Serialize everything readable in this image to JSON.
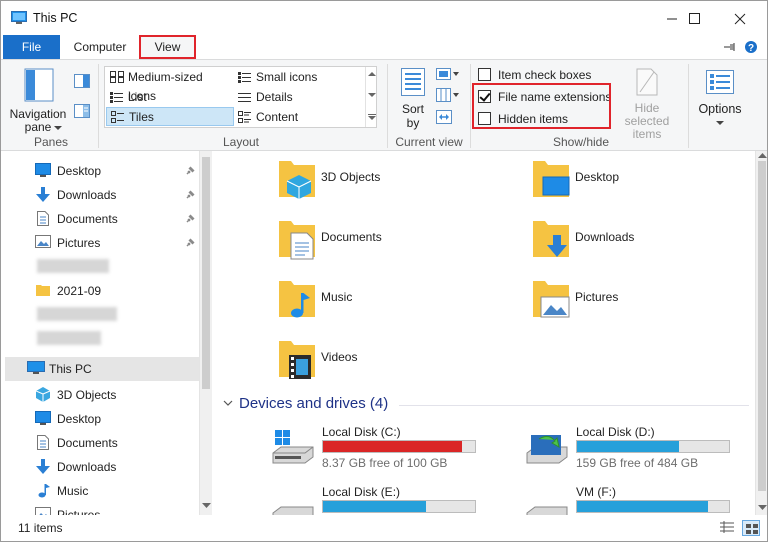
{
  "window": {
    "title": "This PC"
  },
  "ribbon_tabs": {
    "file": "File",
    "computer": "Computer",
    "view": "View"
  },
  "ribbon": {
    "panes": {
      "navigation_pane": "Navigation pane",
      "group_label": "Panes"
    },
    "layout": {
      "items": [
        "Medium-sized icons",
        "Small icons",
        "List",
        "Details",
        "Tiles",
        "Content"
      ],
      "selected": "Tiles",
      "group_label": "Layout"
    },
    "current_view": {
      "sort_by": "Sort by",
      "group_label": "Current view"
    },
    "show_hide": {
      "item_check_boxes": {
        "label": "Item check boxes",
        "checked": false
      },
      "file_name_extensions": {
        "label": "File name extensions",
        "checked": true
      },
      "hidden_items": {
        "label": "Hidden items",
        "checked": false
      },
      "hide_selected_items": "Hide selected items",
      "group_label": "Show/hide"
    },
    "options": "Options"
  },
  "nav_pane": {
    "quick_access": [
      "Desktop",
      "Downloads",
      "Documents",
      "Pictures"
    ],
    "folder_2021": "2021-09",
    "this_pc": "This PC",
    "this_pc_children": [
      "3D Objects",
      "Desktop",
      "Documents",
      "Downloads",
      "Music",
      "Pictures"
    ]
  },
  "folders": [
    "3D Objects",
    "Desktop",
    "Documents",
    "Downloads",
    "Music",
    "Pictures",
    "Videos"
  ],
  "devices_group": {
    "label": "Devices and drives (4)"
  },
  "drives": [
    {
      "name": "Local Disk (C:)",
      "free": "8.37 GB free of 100 GB",
      "used_fraction": 0.916,
      "bar_color": "#da2626"
    },
    {
      "name": "Local Disk (D:)",
      "free": "159 GB free of 484 GB",
      "used_fraction": 0.67,
      "bar_color": "#26a0da"
    },
    {
      "name": "Local Disk (E:)",
      "free": "",
      "used_fraction": 0.68,
      "bar_color": "#26a0da"
    },
    {
      "name": "VM (F:)",
      "free": "",
      "used_fraction": 0.86,
      "bar_color": "#26a0da"
    }
  ],
  "status": {
    "item_count": "11 items"
  },
  "colors": {
    "accent": "#1a6fc9",
    "highlight_red": "#e0242b",
    "group_header": "#1e3287",
    "folder": "#f5c342"
  }
}
